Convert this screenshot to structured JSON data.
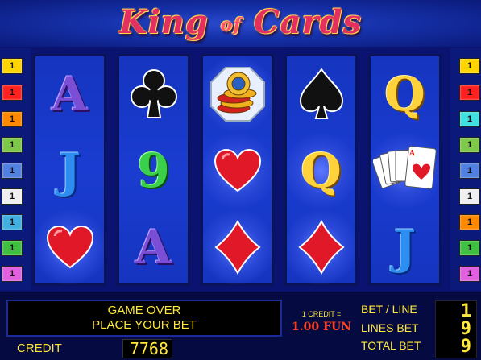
{
  "title": {
    "word1": "King",
    "word2": "of",
    "word3": "Cards"
  },
  "left_lines": [
    {
      "label": "1",
      "color": "#ffd400"
    },
    {
      "label": "1",
      "color": "#ff2020"
    },
    {
      "label": "1",
      "color": "#ff8800"
    },
    {
      "label": "1",
      "color": "#7ec84a"
    },
    {
      "label": "1",
      "color": "#5080e0"
    },
    {
      "label": "1",
      "color": "#f0f0f0"
    },
    {
      "label": "1",
      "color": "#40b0e0"
    },
    {
      "label": "1",
      "color": "#40c040"
    },
    {
      "label": "1",
      "color": "#e060e0"
    }
  ],
  "right_lines": [
    {
      "label": "1",
      "color": "#ffd400"
    },
    {
      "label": "1",
      "color": "#ff2020"
    },
    {
      "label": "1",
      "color": "#40e0e0"
    },
    {
      "label": "1",
      "color": "#7ec84a"
    },
    {
      "label": "1",
      "color": "#5080e0"
    },
    {
      "label": "1",
      "color": "#f0f0f0"
    },
    {
      "label": "1",
      "color": "#ff8800"
    },
    {
      "label": "1",
      "color": "#40c040"
    },
    {
      "label": "1",
      "color": "#e060e0"
    }
  ],
  "reels": [
    [
      {
        "symbol": "A",
        "kind": "letter-a"
      },
      {
        "symbol": "J",
        "kind": "letter-j"
      },
      {
        "symbol": "heart",
        "kind": "heart"
      }
    ],
    [
      {
        "symbol": "club",
        "kind": "club"
      },
      {
        "symbol": "9",
        "kind": "letter-9"
      },
      {
        "symbol": "A",
        "kind": "letter-a"
      }
    ],
    [
      {
        "symbol": "chips",
        "kind": "chips"
      },
      {
        "symbol": "heart",
        "kind": "heart"
      },
      {
        "symbol": "diamond",
        "kind": "diamond"
      }
    ],
    [
      {
        "symbol": "spade",
        "kind": "spade"
      },
      {
        "symbol": "Q",
        "kind": "letter-q"
      },
      {
        "symbol": "diamond",
        "kind": "diamond"
      }
    ],
    [
      {
        "symbol": "Q",
        "kind": "letter-q"
      },
      {
        "symbol": "King cards",
        "kind": "cards"
      },
      {
        "symbol": "J",
        "kind": "letter-j"
      }
    ]
  ],
  "message": {
    "line1": "GAME OVER",
    "line2": "PLACE YOUR BET"
  },
  "credit": {
    "label": "CREDIT",
    "value": "7768"
  },
  "rate": {
    "line1": "1 CREDIT =",
    "line2": "1.00 FUN"
  },
  "bet": {
    "bet_per_line_label": "BET / LINE",
    "lines_bet_label": "LINES BET",
    "total_bet_label": "TOTAL BET",
    "bet_per_line": "1",
    "lines_bet": "9",
    "total_bet": "9"
  }
}
